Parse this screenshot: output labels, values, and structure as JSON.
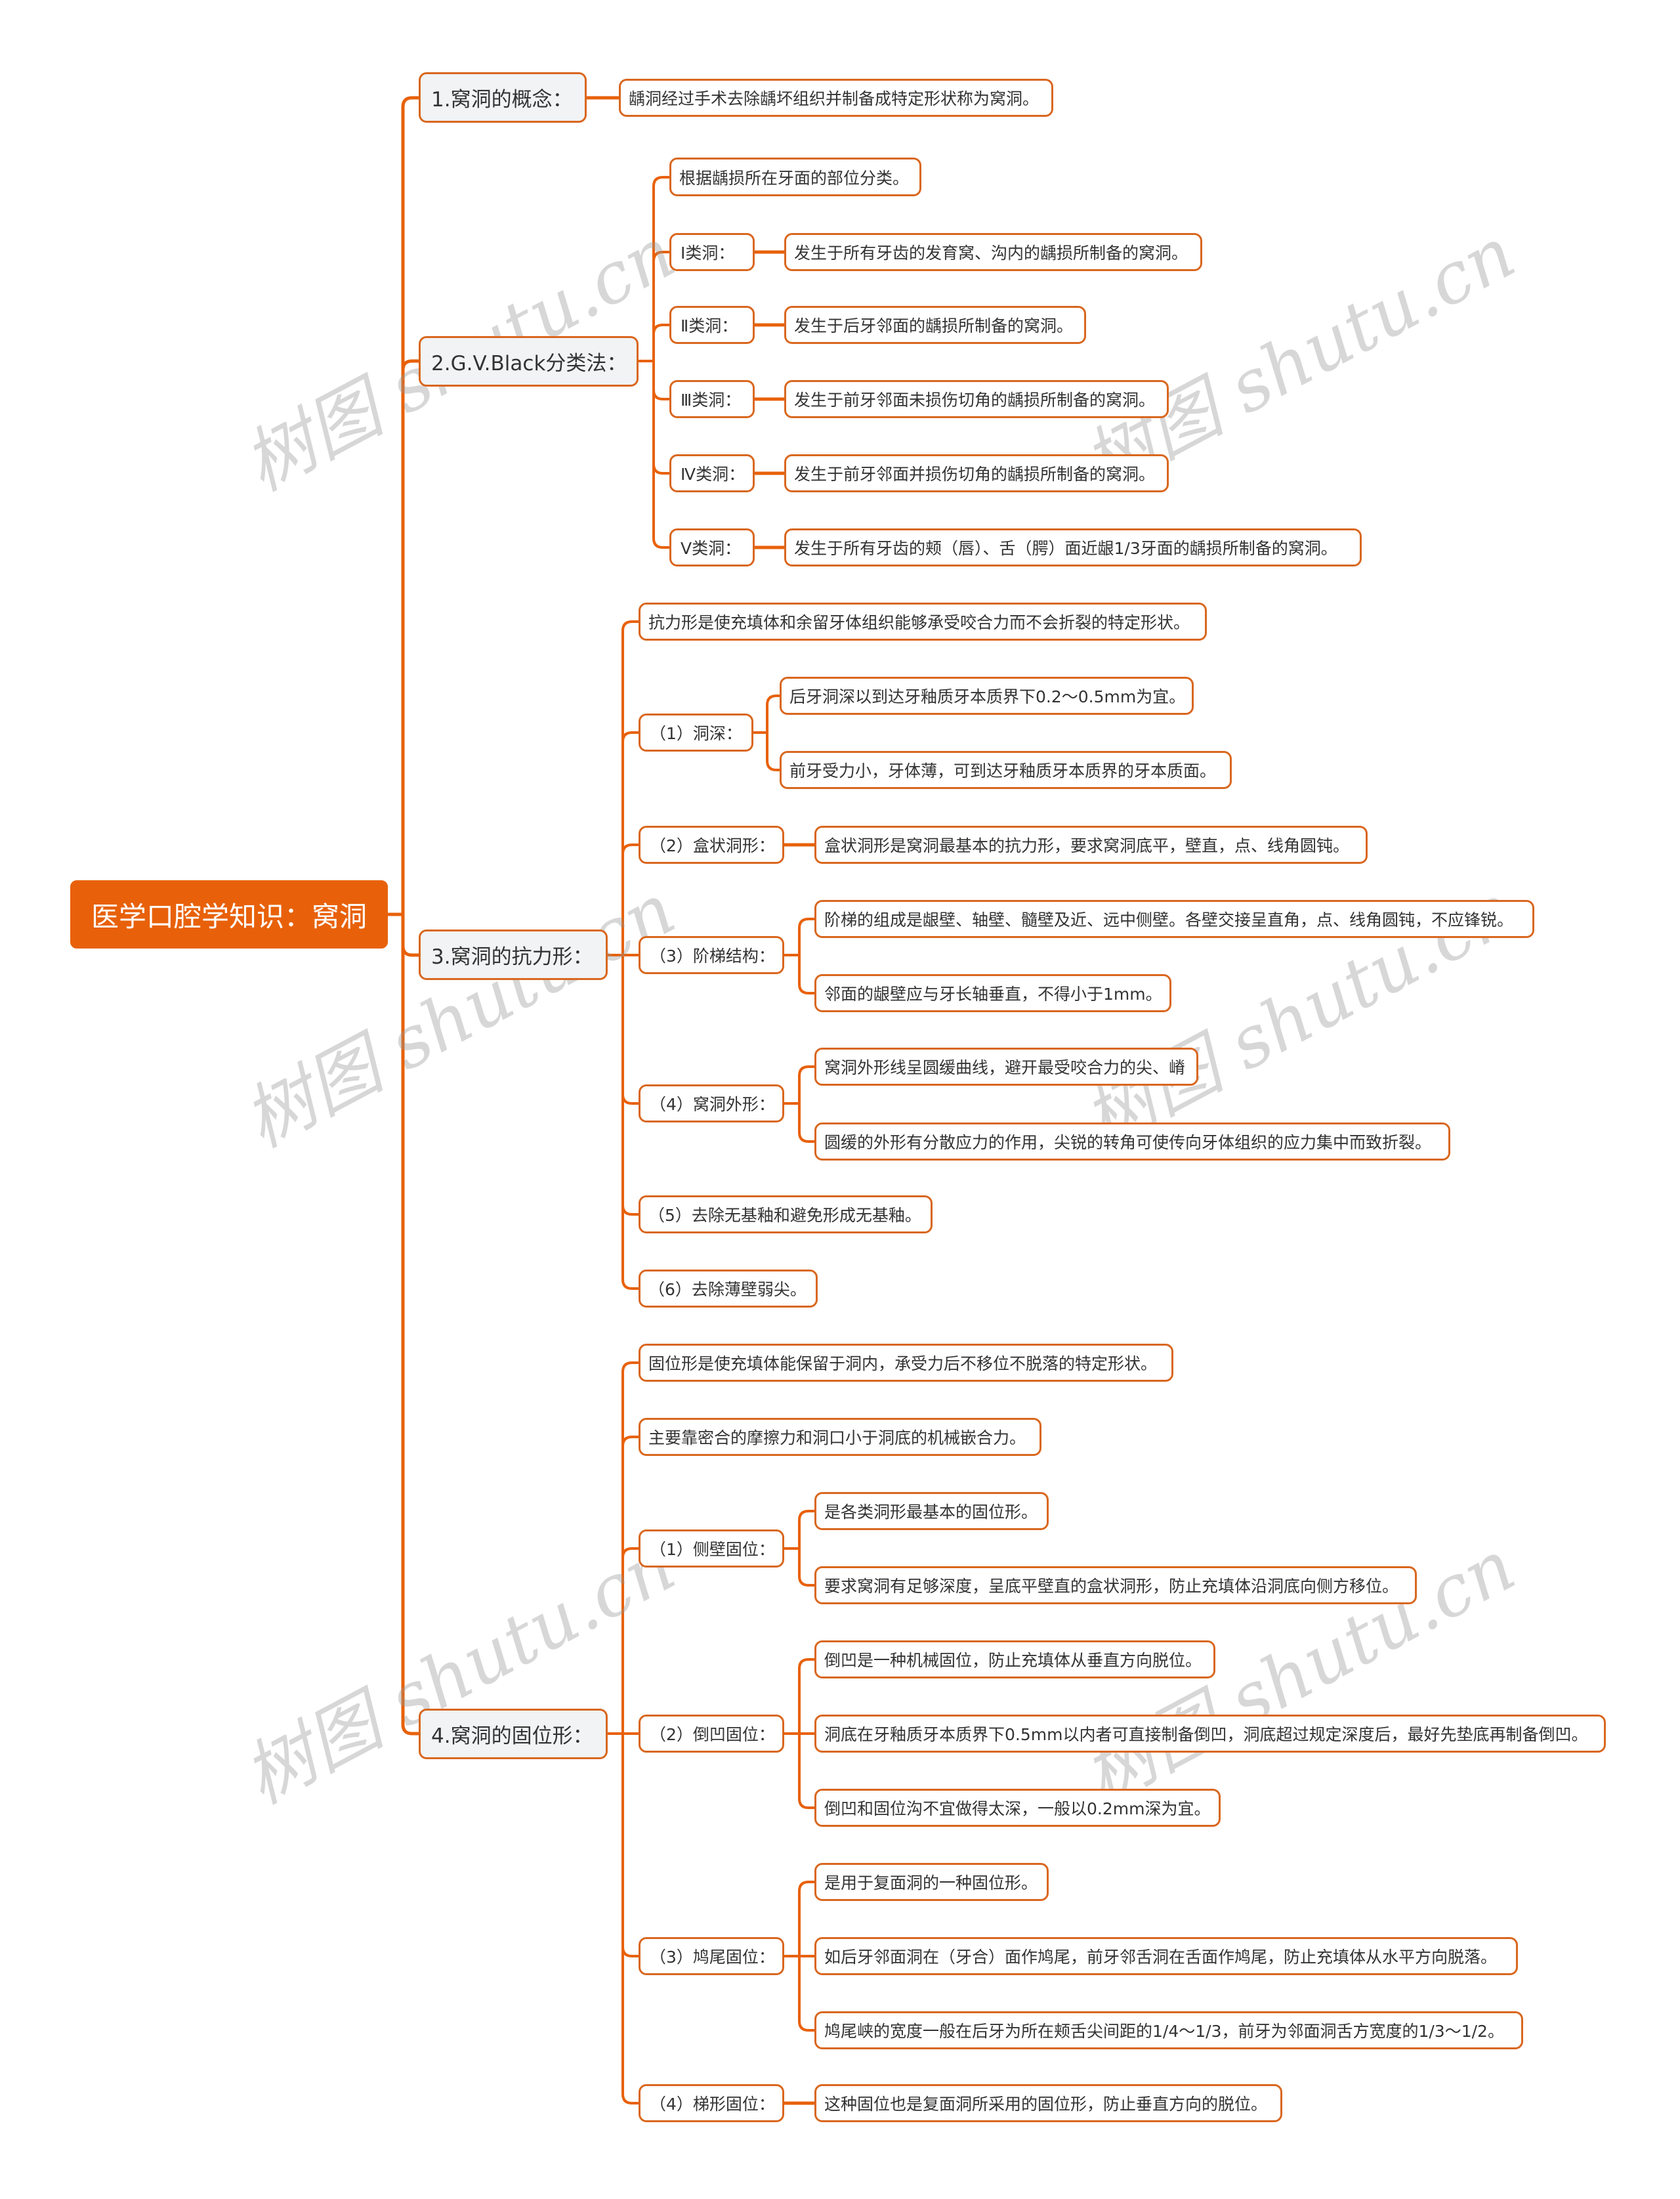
{
  "root": {
    "label": "医学口腔学知识：窝洞"
  },
  "accent_color": "#e8610a",
  "watermark": "树图 shutu.cn",
  "sections": [
    {
      "label": "1.窝洞的概念：",
      "children": [
        {
          "label": "龋洞经过手术去除龋坏组织并制备成特定形状称为窝洞。"
        }
      ]
    },
    {
      "label": "2.G.V.Black分类法：",
      "children": [
        {
          "label": "根据龋损所在牙面的部位分类。"
        },
        {
          "label": "Ⅰ类洞：",
          "children": [
            {
              "label": "发生于所有牙齿的发育窝、沟内的龋损所制备的窝洞。"
            }
          ]
        },
        {
          "label": "Ⅱ类洞：",
          "children": [
            {
              "label": "发生于后牙邻面的龋损所制备的窝洞。"
            }
          ]
        },
        {
          "label": "Ⅲ类洞：",
          "children": [
            {
              "label": "发生于前牙邻面未损伤切角的龋损所制备的窝洞。"
            }
          ]
        },
        {
          "label": "Ⅳ类洞：",
          "children": [
            {
              "label": "发生于前牙邻面并损伤切角的龋损所制备的窝洞。"
            }
          ]
        },
        {
          "label": "Ⅴ类洞：",
          "children": [
            {
              "label": "发生于所有牙齿的颊（唇）、舌（腭）面近龈1/3牙面的龋损所制备的窝洞。"
            }
          ]
        }
      ]
    },
    {
      "label": "3.窝洞的抗力形：",
      "children": [
        {
          "label": "抗力形是使充填体和余留牙体组织能够承受咬合力而不会折裂的特定形状。"
        },
        {
          "label": "（1）洞深：",
          "children": [
            {
              "label": "后牙洞深以到达牙釉质牙本质界下0.2～0.5mm为宜。"
            },
            {
              "label": "前牙受力小，牙体薄，可到达牙釉质牙本质界的牙本质面。"
            }
          ]
        },
        {
          "label": "（2）盒状洞形：",
          "children": [
            {
              "label": "盒状洞形是窝洞最基本的抗力形，要求窝洞底平，壁直，点、线角圆钝。"
            }
          ]
        },
        {
          "label": "（3）阶梯结构：",
          "children": [
            {
              "label": "阶梯的组成是龈壁、轴壁、髓壁及近、远中侧壁。各壁交接呈直角，点、线角圆钝，不应锋锐。"
            },
            {
              "label": "邻面的龈壁应与牙长轴垂直，不得小于1mm。"
            }
          ]
        },
        {
          "label": "（4）窝洞外形：",
          "children": [
            {
              "label": "窝洞外形线呈圆缓曲线，避开最受咬合力的尖、嵴"
            },
            {
              "label": "圆缓的外形有分散应力的作用，尖锐的转角可使传向牙体组织的应力集中而致折裂。"
            }
          ]
        },
        {
          "label": "（5）去除无基釉和避免形成无基釉。"
        },
        {
          "label": "（6）去除薄壁弱尖。"
        }
      ]
    },
    {
      "label": "4.窝洞的固位形：",
      "children": [
        {
          "label": "固位形是使充填体能保留于洞内，承受力后不移位不脱落的特定形状。"
        },
        {
          "label": "主要靠密合的摩擦力和洞口小于洞底的机械嵌合力。"
        },
        {
          "label": "（1）侧壁固位：",
          "children": [
            {
              "label": "是各类洞形最基本的固位形。"
            },
            {
              "label": "要求窝洞有足够深度，呈底平壁直的盒状洞形，防止充填体沿洞底向侧方移位。"
            }
          ]
        },
        {
          "label": "（2）倒凹固位：",
          "children": [
            {
              "label": "倒凹是一种机械固位，防止充填体从垂直方向脱位。"
            },
            {
              "label": "洞底在牙釉质牙本质界下0.5mm以内者可直接制备倒凹，洞底超过规定深度后，最好先垫底再制备倒凹。"
            },
            {
              "label": "倒凹和固位沟不宜做得太深，一般以0.2mm深为宜。"
            }
          ]
        },
        {
          "label": "（3）鸠尾固位：",
          "children": [
            {
              "label": "是用于复面洞的一种固位形。"
            },
            {
              "label": "如后牙邻面洞在（牙合）面作鸠尾，前牙邻舌洞在舌面作鸠尾，防止充填体从水平方向脱落。"
            },
            {
              "label": "鸠尾峡的宽度一般在后牙为所在颊舌尖间距的1/4～1/3，前牙为邻面洞舌方宽度的1/3～1/2。"
            }
          ]
        },
        {
          "label": "（4）梯形固位：",
          "children": [
            {
              "label": "这种固位也是复面洞所采用的固位形，防止垂直方向的脱位。"
            }
          ]
        }
      ]
    }
  ]
}
